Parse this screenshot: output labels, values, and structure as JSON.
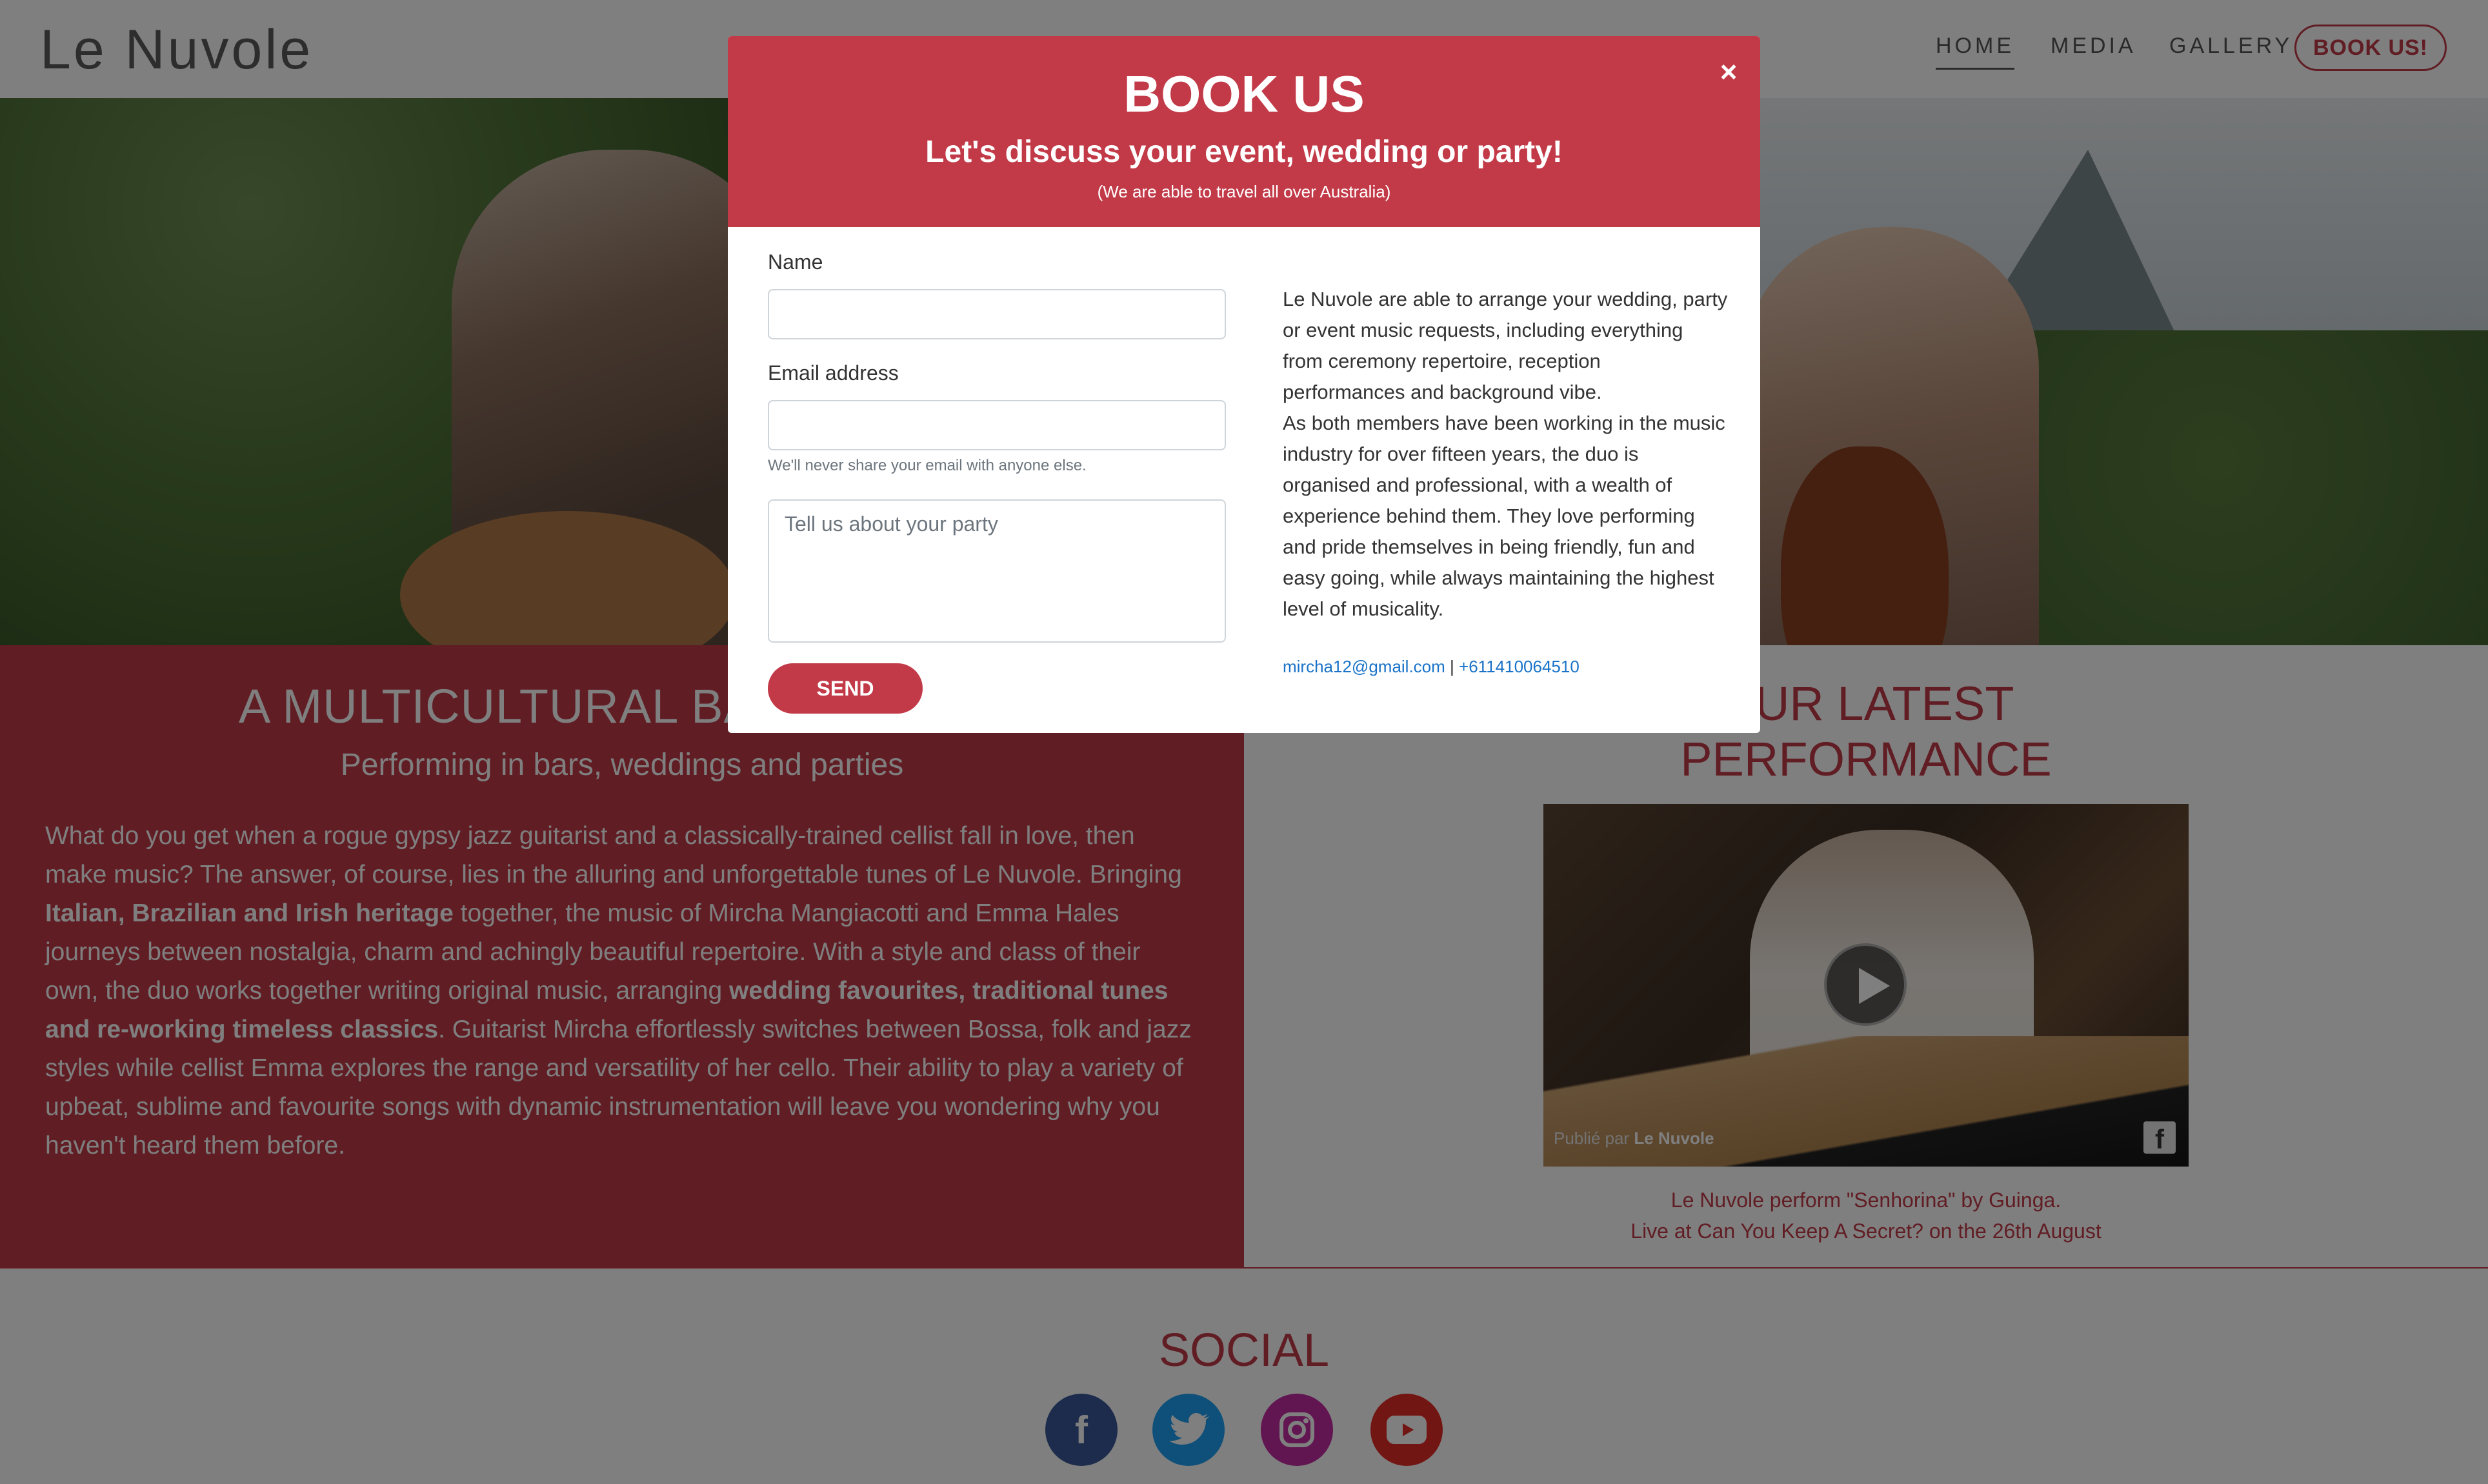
{
  "navbar": {
    "brand": "Le Nuvole",
    "links": [
      "HOME",
      "MEDIA",
      "GALLERY"
    ],
    "cta": "BOOK US!"
  },
  "about": {
    "heading": "A MULTICULTURAL BAND BASED",
    "subheading": "Performing in bars, weddings and parties",
    "paragraph": [
      "What do you get when a rogue gypsy jazz guitarist and a classically-trained cellist fall in love, then make music? The answer, of course, lies in the alluring and unforgettable tunes of Le Nuvole. Bringing ",
      "Italian, Brazilian and Irish heritage",
      " together, the music of Mircha Mangiacotti and Emma Hales journeys between nostalgia, charm and achingly beautiful repertoire. With a style and class of their own, the duo works together writing original music, arranging ",
      "wedding favourites, traditional tunes and re-working timeless classics",
      ". Guitarist Mircha effortlessly switches between Bossa, folk and jazz styles while cellist Emma explores the range and versatility of her cello. Their ability to play a variety of upbeat, sublime and favourite songs with dynamic instrumentation will leave you wondering why you haven't heard them before."
    ]
  },
  "performance": {
    "heading_line1": "OUR LATEST",
    "heading_line2": "PERFORMANCE",
    "video_credit_prefix": "Publié par",
    "video_credit_name": "Le Nuvole",
    "caption_line1": "Le Nuvole perform \"Senhorina\" by Guinga.",
    "caption_line2": "Live at Can You Keep A Secret? on the 26th August"
  },
  "social": {
    "heading": "SOCIAL",
    "icons": [
      "facebook-icon",
      "twitter-icon",
      "instagram-icon",
      "youtube-icon"
    ]
  },
  "modal": {
    "title": "BOOK US",
    "subtitle": "Let's discuss your event, wedding or party!",
    "note": "(We are able to travel all over Australia)",
    "close": "×",
    "name_label": "Name",
    "name_value": "",
    "email_label": "Email address",
    "email_value": "",
    "email_help": "We'll never share your email with anyone else.",
    "message_placeholder": "Tell us about your party",
    "send_label": "SEND",
    "text1": "Le Nuvole are able to arrange your wedding, party or event music requests, including everything from ceremony repertoire, reception performances and background vibe.",
    "text2": "As both members have been working in the music industry for over fifteen years, the duo is organised and professional, with a wealth of experience behind them. They love performing and pride themselves in being friendly, fun and easy going, while always maintaining the highest level of musicality.",
    "email_link": "mircha12@gmail.com",
    "separator": " | ",
    "phone_link": "+611410064510"
  },
  "colors": {
    "accent": "#c23a48",
    "overlay": "rgba(0,0,0,0.5)",
    "link": "#1a73c8"
  }
}
